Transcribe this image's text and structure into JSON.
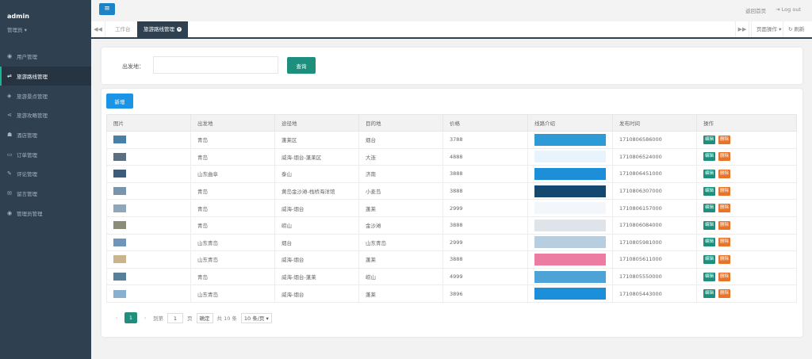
{
  "sidebar": {
    "username": "admin",
    "role": "管理员 ▾",
    "items": [
      {
        "label": "用户管理",
        "icon": "◉"
      },
      {
        "label": "旅游路线管理",
        "icon": "⇌"
      },
      {
        "label": "旅游景点管理",
        "icon": "◈"
      },
      {
        "label": "旅游攻略管理",
        "icon": "⋖"
      },
      {
        "label": "酒店管理",
        "icon": "☗"
      },
      {
        "label": "订单管理",
        "icon": "▭"
      },
      {
        "label": "评论管理",
        "icon": "✎"
      },
      {
        "label": "留言管理",
        "icon": "✉"
      },
      {
        "label": "管理员管理",
        "icon": "◉"
      }
    ]
  },
  "header": {
    "menu_toggle": "≡",
    "home_link": "返回首页",
    "logout": "Log out",
    "logout_icon": "⇥"
  },
  "tabs": {
    "prev_icon": "◀◀",
    "next_icon": "▶▶",
    "items": [
      {
        "label": "工作台"
      },
      {
        "label": "旅游路线管理",
        "close": "×"
      }
    ],
    "page_ops": "页面操作 ▾",
    "refresh": "↻ 刷新"
  },
  "search": {
    "label": "出发地：",
    "input_value": "",
    "button": "查询"
  },
  "list": {
    "add_button": "新增",
    "columns": [
      "图片",
      "出发地",
      "途径地",
      "目的地",
      "价格",
      "线路介绍",
      "发布时间",
      "操作"
    ],
    "rows": [
      {
        "from": "青岛",
        "via": "蓬莱区",
        "to": "烟台",
        "price": "3788",
        "time": "1710806586000",
        "thumb": "#4a7fa8",
        "banner": "#2e9ad6"
      },
      {
        "from": "青岛",
        "via": "威海-烟台-蓬莱区",
        "to": "大连",
        "price": "4888",
        "time": "1710806524000",
        "thumb": "#5b6f80",
        "banner": "#e9f3fb"
      },
      {
        "from": "山东曲阜",
        "via": "泰山",
        "to": "济南",
        "price": "3888",
        "time": "1710806451000",
        "thumb": "#3d5c7a",
        "banner": "#1d8ed8"
      },
      {
        "from": "青岛",
        "via": "黄岛金沙滩-栈桥海洋馆",
        "to": "小麦岛",
        "price": "3888",
        "time": "1710806307000",
        "thumb": "#7a95ab",
        "banner": "#15486e"
      },
      {
        "from": "青岛",
        "via": "威海-烟台",
        "to": "蓬莱",
        "price": "2999",
        "time": "1710806157000",
        "thumb": "#8fa7b8",
        "banner": "#f3f6fa"
      },
      {
        "from": "青岛",
        "via": "崂山",
        "to": "金沙滩",
        "price": "3888",
        "time": "1710806084000",
        "thumb": "#8c8c7a",
        "banner": "#dfe4ea"
      },
      {
        "from": "山东青岛",
        "via": "烟台",
        "to": "山东青岛",
        "price": "2999",
        "time": "1710805981000",
        "thumb": "#6f96b8",
        "banner": "#b7cde0"
      },
      {
        "from": "山东青岛",
        "via": "威海-烟台",
        "to": "蓬莱",
        "price": "3888",
        "time": "1710805611000",
        "thumb": "#c9b48e",
        "banner": "#ec7ca2"
      },
      {
        "from": "青岛",
        "via": "威海-烟台-蓬莱",
        "to": "崂山",
        "price": "4999",
        "time": "1710805550000",
        "thumb": "#5a7f9b",
        "banner": "#4ea3d6"
      },
      {
        "from": "山东青岛",
        "via": "威海-烟台",
        "to": "蓬莱",
        "price": "3896",
        "time": "1710805443000",
        "thumb": "#8ab0cf",
        "banner": "#1b8fd9"
      }
    ],
    "edit_label": "编辑",
    "delete_label": "删除"
  },
  "pagination": {
    "prev": "‹",
    "current": "1",
    "next": "›",
    "goto_label": "到第",
    "goto_value": "1",
    "page_unit": "页",
    "confirm": "确定",
    "total": "共 10 条",
    "page_size": "10 条/页 ▾"
  },
  "colors": {
    "sidebar_bg": "#2f4050",
    "primary": "#1e8f7d",
    "add_blue": "#1c94e6",
    "delete_orange": "#e8742a"
  }
}
